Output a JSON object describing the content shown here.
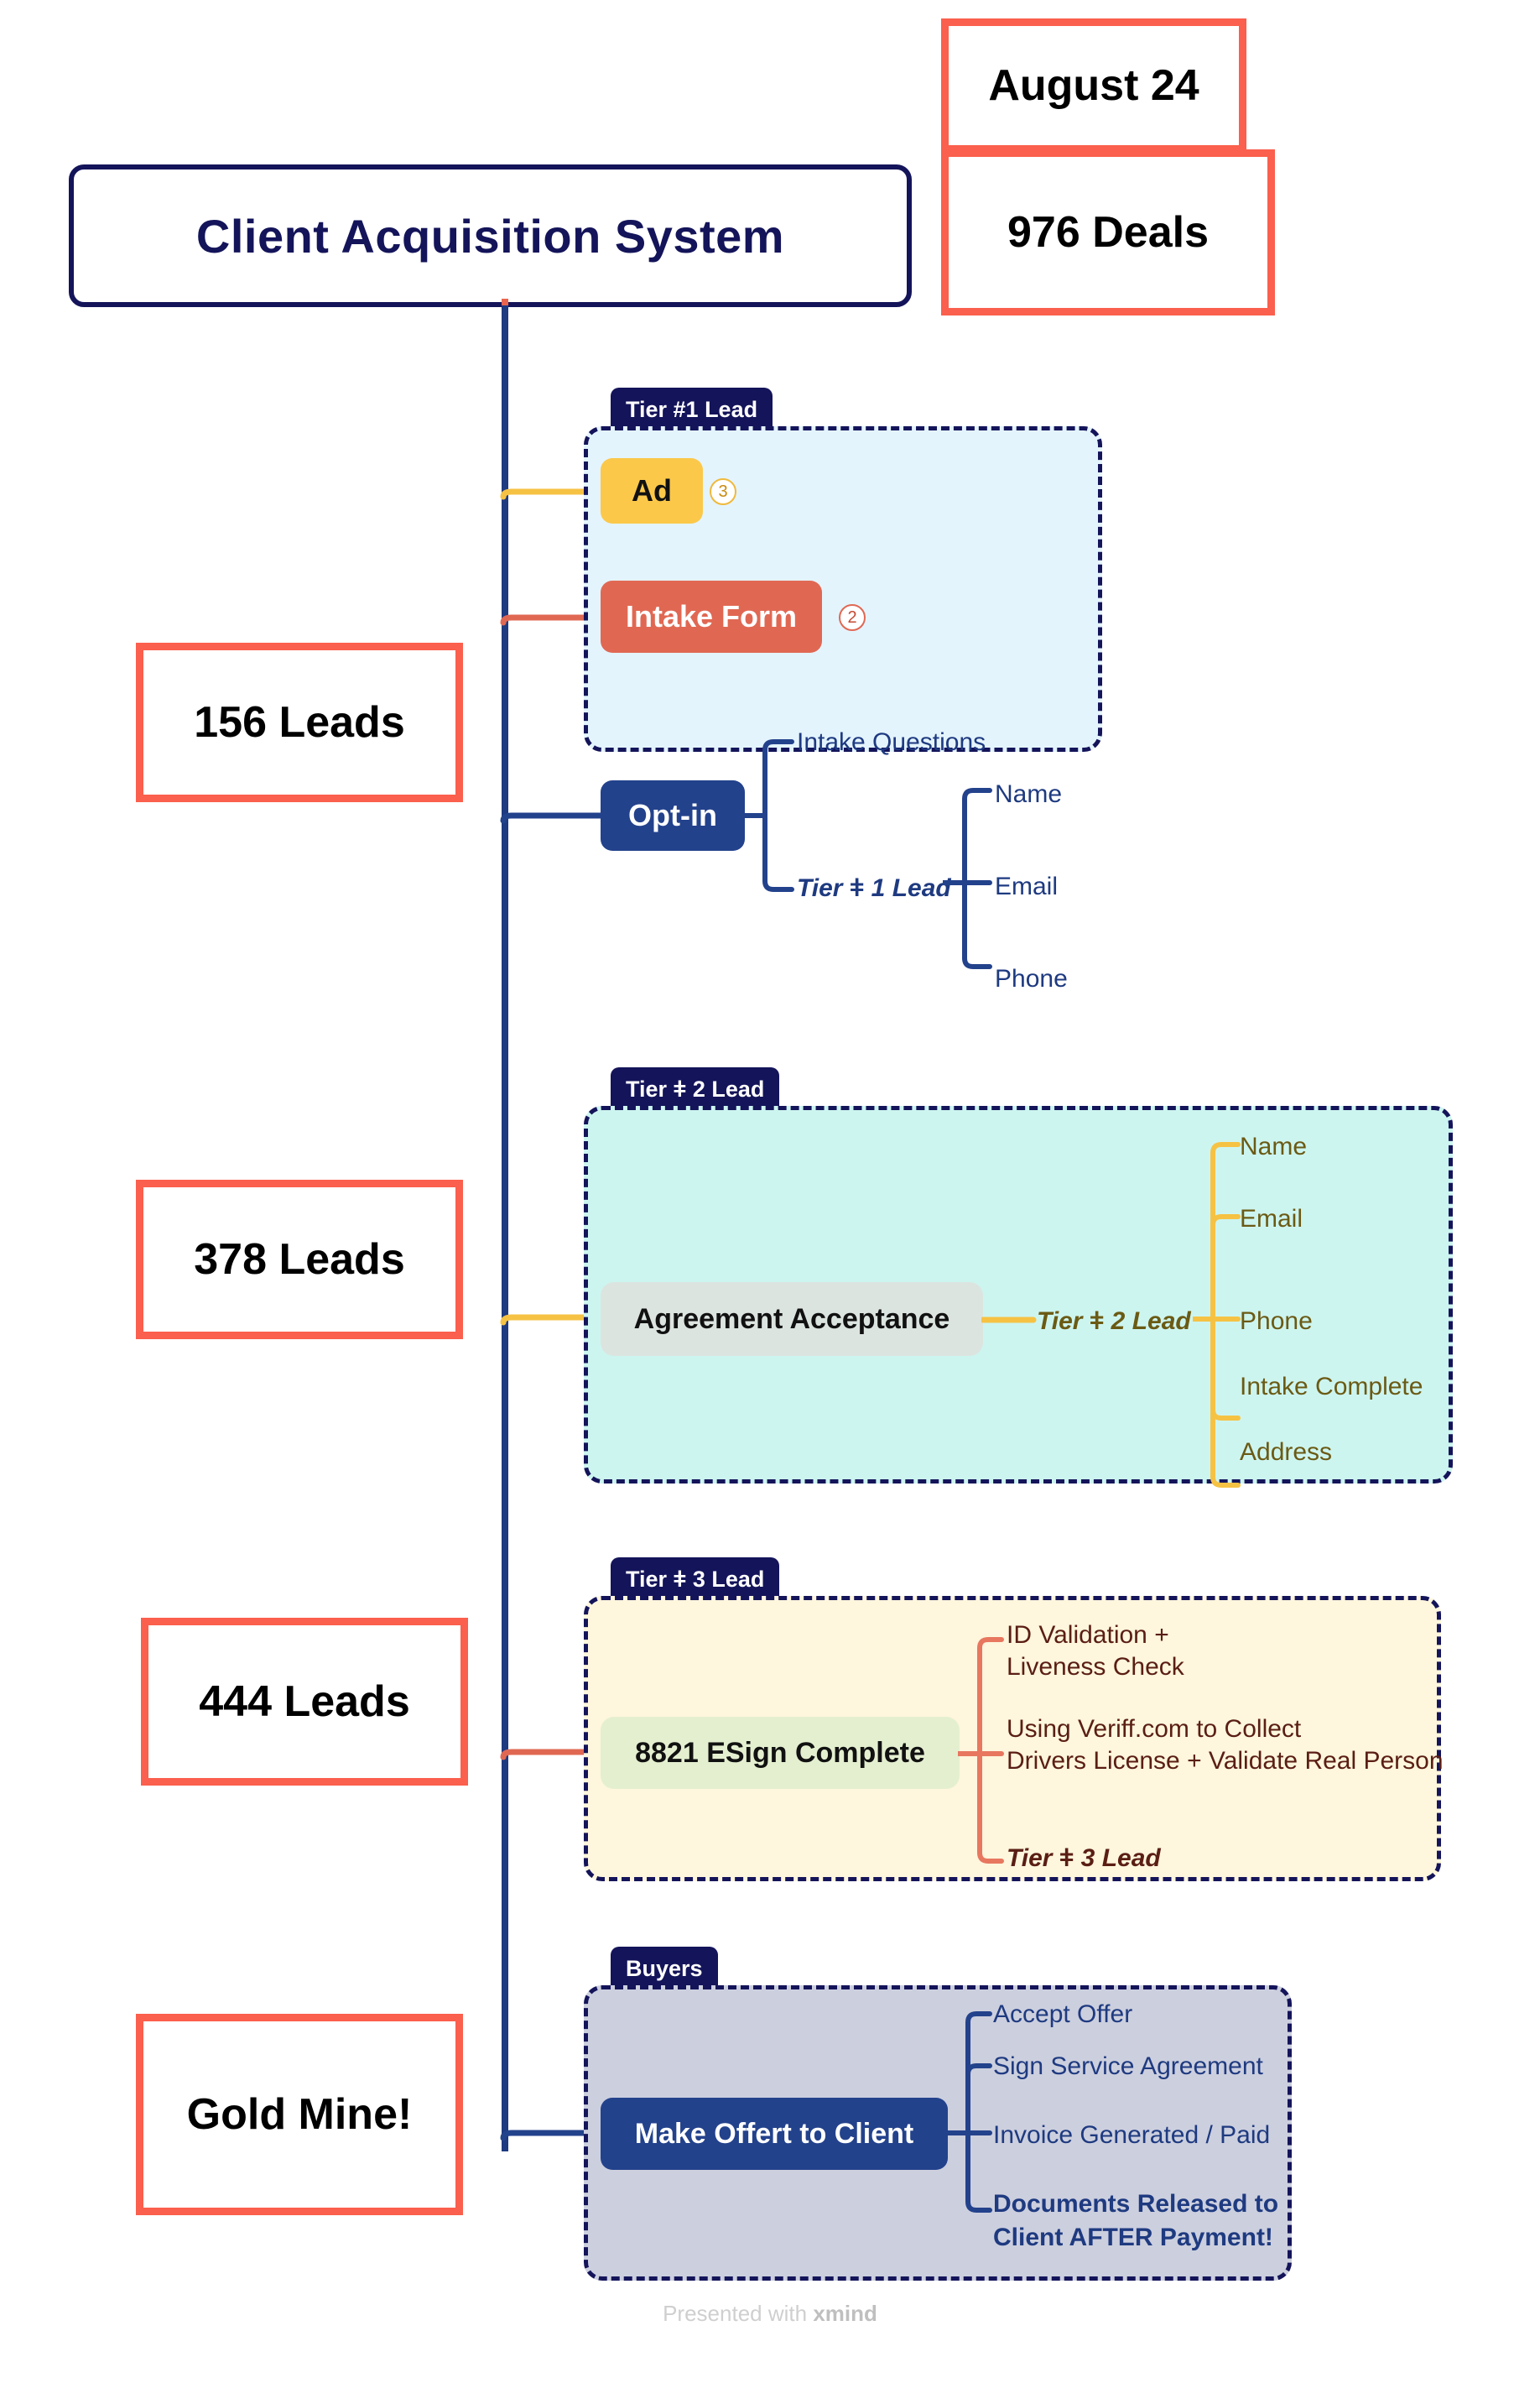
{
  "root": {
    "title": "Client Acquisition System"
  },
  "callouts": [
    {
      "id": "date",
      "text": "August 24"
    },
    {
      "id": "deals",
      "text": "976 Deals"
    },
    {
      "id": "t1",
      "text": "156 Leads"
    },
    {
      "id": "t2",
      "text": "378 Leads"
    },
    {
      "id": "t3",
      "text": "444 Leads"
    },
    {
      "id": "buyers",
      "text": "Gold Mine!"
    }
  ],
  "groups": [
    {
      "label": "Tier #1 Lead",
      "fill": "#E4F4FD",
      "topics": [
        {
          "text": "Ad",
          "badge": "3"
        },
        {
          "text": "Intake Form",
          "badge": "2"
        },
        {
          "text": "Opt-in",
          "badge": ""
        }
      ],
      "leaves": {
        "intake_questions": "Intake Questions",
        "tier_label": "Tier ǂ 1 Lead",
        "fields": [
          "Name",
          "Email",
          "Phone"
        ]
      }
    },
    {
      "label": "Tier ǂ 2 Lead",
      "fill": "#CDF5F0",
      "topics": [
        {
          "text": "Agreement  Acceptance",
          "badge": ""
        }
      ],
      "leaves": {
        "tier_label": "Tier ǂ 2 Lead",
        "fields": [
          "Name",
          "Email",
          "Phone",
          "Intake Complete",
          "Address"
        ]
      }
    },
    {
      "label": "Tier ǂ 3 Lead",
      "fill": "#FEF6DD",
      "topics": [
        {
          "text": "8821 ESign Complete",
          "badge": ""
        }
      ],
      "leaves": {
        "item1_line1": "ID Validation +",
        "item1_line2": "Liveness Check",
        "item2_line1": "Using Veriff.com to Collect",
        "item2_line2": "Drivers License + Validate Real Person",
        "tier_label": "Tier ǂ 3 Lead"
      }
    },
    {
      "label": "Buyers",
      "fill": "#CCCFDE",
      "topics": [
        {
          "text": "Make Offert to Client",
          "badge": ""
        }
      ],
      "leaves": {
        "step1": "Accept Offer",
        "step2": "Sign Service Agreement",
        "step3": "Invoice Generated / Paid",
        "step4_line1": "Documents Released to",
        "step4_line2": "Client AFTER Payment!"
      }
    }
  ],
  "footer": {
    "prefix": "Presented with ",
    "brand": "xmind"
  },
  "colors": {
    "root_border": "#14145A",
    "callout_border": "#FB5F4D",
    "trunk": "#1E3A80",
    "yellow": "#FBC84A",
    "coral": "#E06853",
    "navy": "#23428C"
  }
}
